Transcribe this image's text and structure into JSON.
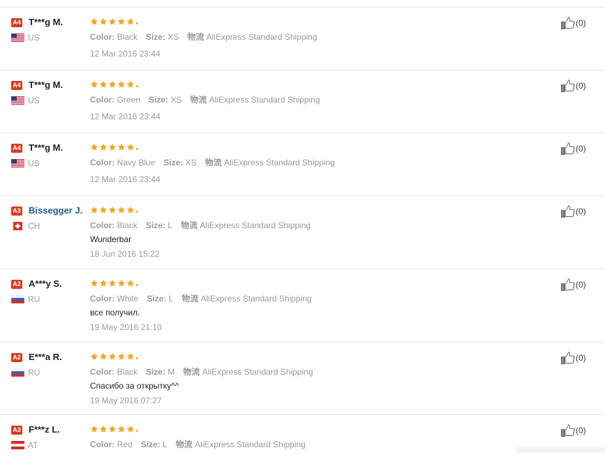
{
  "labels": {
    "color": "Color:",
    "size": "Size:",
    "shipping_label": "物流",
    "shipping_value": "AliExpress Standard Shipping"
  },
  "colors": {
    "badge": "#d83a1f",
    "star": "#f5a623",
    "link_name": "#1f5b9a",
    "muted_text": "#999999"
  },
  "reviews": [
    {
      "badge": "A4",
      "name": "T***g M.",
      "name_link": false,
      "flag": "us",
      "country": "US",
      "stars": 5,
      "color": "Black",
      "size": "XS",
      "feedback": "",
      "date": "12 Mar 2016 23:44",
      "likes": "(0)"
    },
    {
      "badge": "A4",
      "name": "T***g M.",
      "name_link": false,
      "flag": "us",
      "country": "US",
      "stars": 5,
      "color": "Green",
      "size": "XS",
      "feedback": "",
      "date": "12 Mar 2016 23:44",
      "likes": "(0)"
    },
    {
      "badge": "A4",
      "name": "T***g M.",
      "name_link": false,
      "flag": "us",
      "country": "US",
      "stars": 5,
      "color": "Navy Blue",
      "size": "XS",
      "feedback": "",
      "date": "12 Mar 2016 23:44",
      "likes": "(0)"
    },
    {
      "badge": "A3",
      "name": "Bissegger J.",
      "name_link": true,
      "flag": "ch",
      "country": "CH",
      "stars": 5,
      "color": "Black",
      "size": "L",
      "feedback": "Wunderbar",
      "date": "18 Jun 2016 15:22",
      "likes": "(0)"
    },
    {
      "badge": "A2",
      "name": "A***y S.",
      "name_link": false,
      "flag": "ru",
      "country": "RU",
      "stars": 5,
      "color": "White",
      "size": "L",
      "feedback": "все получил.",
      "date": "19 May 2016 21:10",
      "likes": "(0)"
    },
    {
      "badge": "A2",
      "name": "E***a R.",
      "name_link": false,
      "flag": "ru",
      "country": "RU",
      "stars": 5,
      "color": "Black",
      "size": "M",
      "feedback": "Спасибо за открытку^^",
      "date": "19 May 2016 07:27",
      "likes": "(0)"
    },
    {
      "badge": "A3",
      "name": "F***z L.",
      "name_link": false,
      "flag": "at",
      "country": "AT",
      "stars": 5,
      "color": "Red",
      "size": "L",
      "feedback": "",
      "date": "",
      "likes": "(0)"
    }
  ]
}
